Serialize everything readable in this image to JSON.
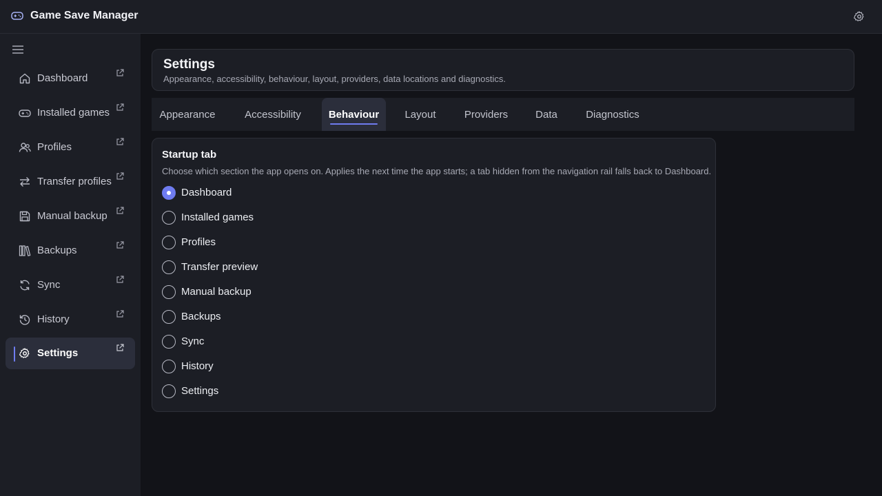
{
  "app": {
    "title": "Game Save Manager",
    "logo_icon": "gamepad-icon",
    "settings_icon": "gear-icon"
  },
  "colors": {
    "accent": "#6f7cf0",
    "surface": "#1c1e25",
    "background": "#121318"
  },
  "sidebar": {
    "items": [
      {
        "label": "Dashboard",
        "icon": "home-icon",
        "active": false
      },
      {
        "label": "Installed games",
        "icon": "gamepad-icon",
        "active": false
      },
      {
        "label": "Profiles",
        "icon": "users-icon",
        "active": false
      },
      {
        "label": "Transfer profiles",
        "icon": "swap-icon",
        "active": false
      },
      {
        "label": "Manual backup",
        "icon": "save-icon",
        "active": false
      },
      {
        "label": "Backups",
        "icon": "library-icon",
        "active": false
      },
      {
        "label": "Sync",
        "icon": "refresh-icon",
        "active": false
      },
      {
        "label": "History",
        "icon": "history-icon",
        "active": false
      },
      {
        "label": "Settings",
        "icon": "gear-icon",
        "active": true
      }
    ]
  },
  "header": {
    "title": "Settings",
    "subtitle": "Appearance, accessibility, behaviour, layout, providers, data locations and diagnostics."
  },
  "tabs": [
    {
      "label": "Appearance",
      "active": false
    },
    {
      "label": "Accessibility",
      "active": false
    },
    {
      "label": "Behaviour",
      "active": true
    },
    {
      "label": "Layout",
      "active": false
    },
    {
      "label": "Providers",
      "active": false
    },
    {
      "label": "Data",
      "active": false
    },
    {
      "label": "Diagnostics",
      "active": false
    }
  ],
  "startup": {
    "title": "Startup tab",
    "description": "Choose which section the app opens on. Applies the next time the app starts; a tab hidden from the navigation rail falls back to Dashboard.",
    "selected": "Dashboard",
    "options": [
      "Dashboard",
      "Installed games",
      "Profiles",
      "Transfer preview",
      "Manual backup",
      "Backups",
      "Sync",
      "History",
      "Settings"
    ]
  }
}
